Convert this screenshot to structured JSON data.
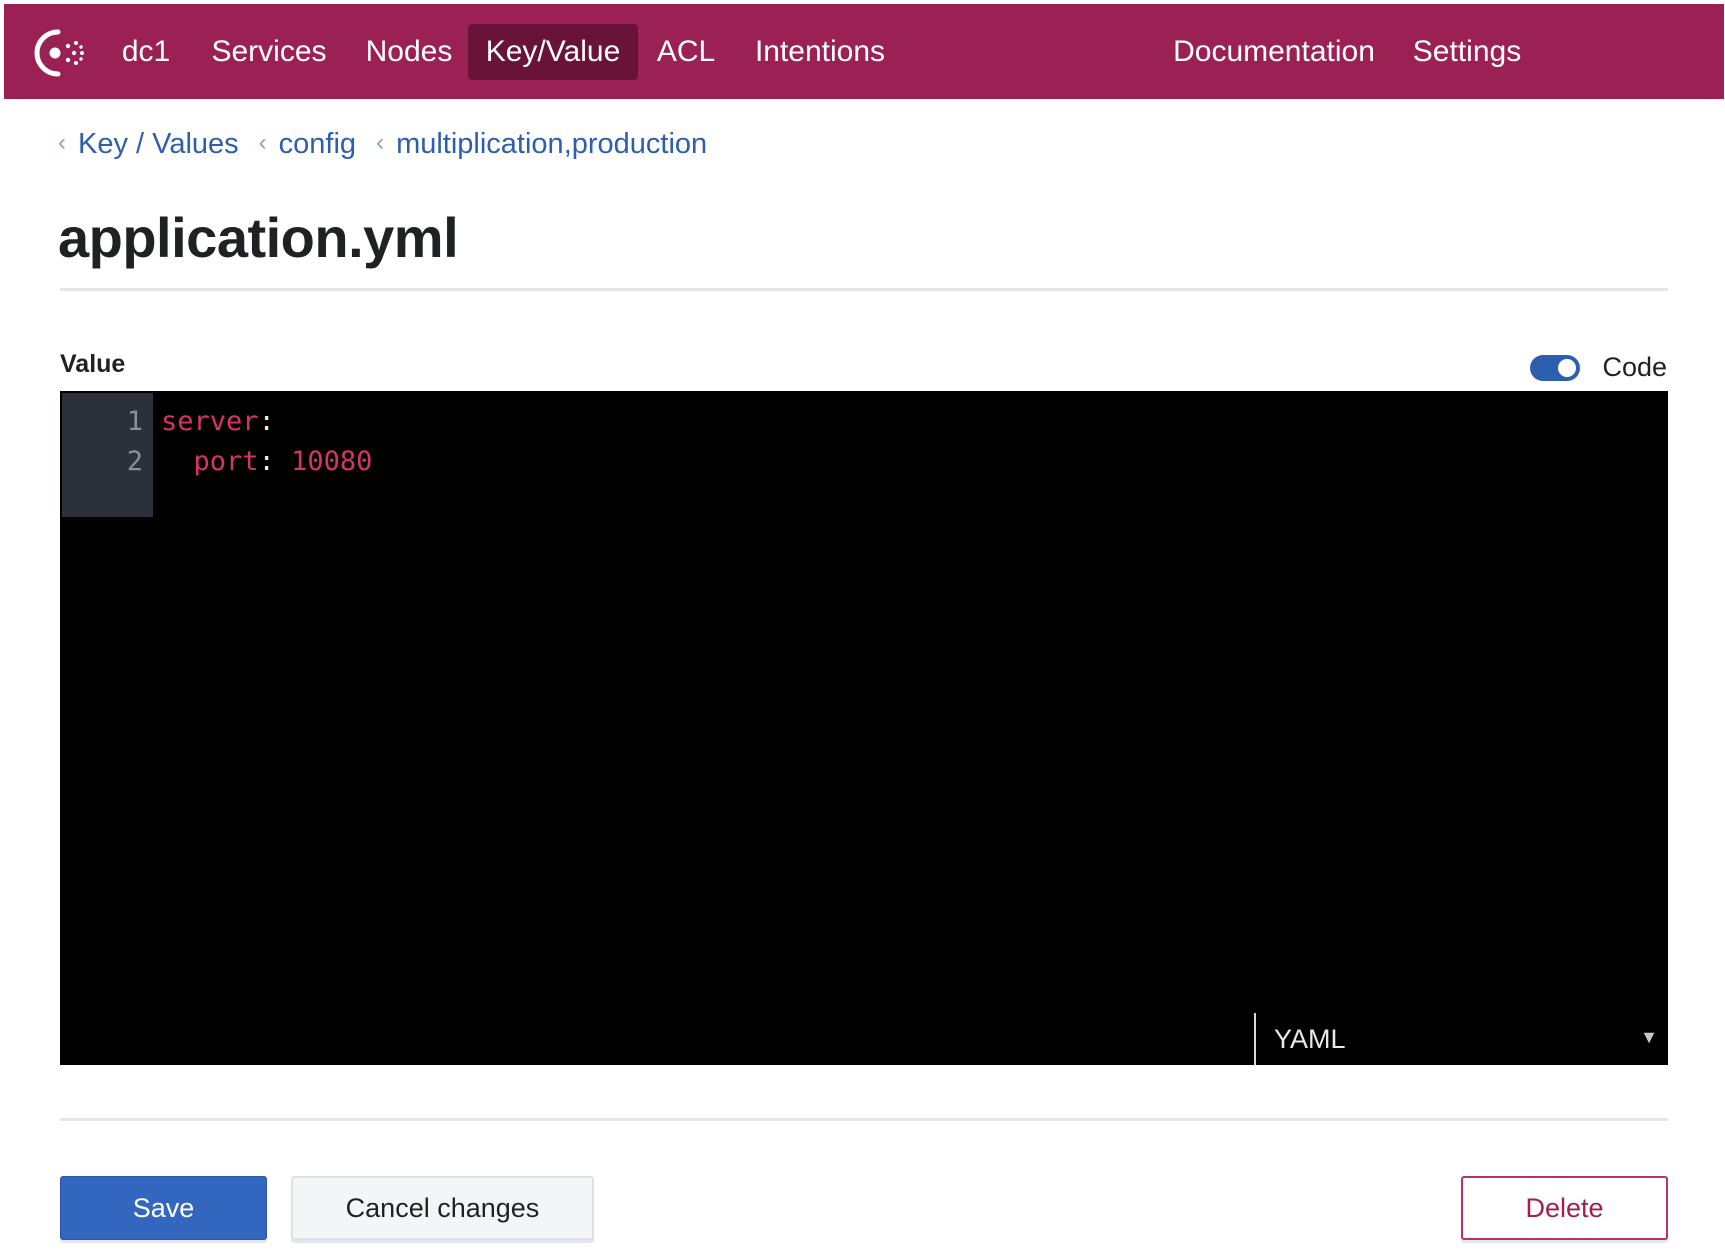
{
  "topnav": {
    "datacenter": "dc1",
    "items": [
      {
        "label": "Services"
      },
      {
        "label": "Nodes"
      },
      {
        "label": "Key/Value"
      },
      {
        "label": "ACL"
      },
      {
        "label": "Intentions"
      }
    ],
    "active_item": "Key/Value",
    "right_items": [
      {
        "label": "Documentation"
      },
      {
        "label": "Settings"
      }
    ],
    "brand_color": "#9b2155",
    "active_bg": "#6a1338"
  },
  "breadcrumb": [
    {
      "label": "Key / Values"
    },
    {
      "label": "config"
    },
    {
      "label": "multiplication,production"
    }
  ],
  "page": {
    "title": "application.yml"
  },
  "value_section": {
    "label": "Value",
    "code_toggle": {
      "label": "Code",
      "enabled": true
    }
  },
  "editor": {
    "lines": [
      {
        "number": "1",
        "key": "server",
        "colon": ":",
        "value": ""
      },
      {
        "number": "2",
        "indent": "  ",
        "key": "port",
        "colon": ":",
        "value": " 10080"
      }
    ],
    "mode": {
      "selected": "YAML",
      "arrow_icon": "triangle-down"
    }
  },
  "actions": {
    "save_label": "Save",
    "cancel_label": "Cancel changes",
    "delete_label": "Delete"
  }
}
